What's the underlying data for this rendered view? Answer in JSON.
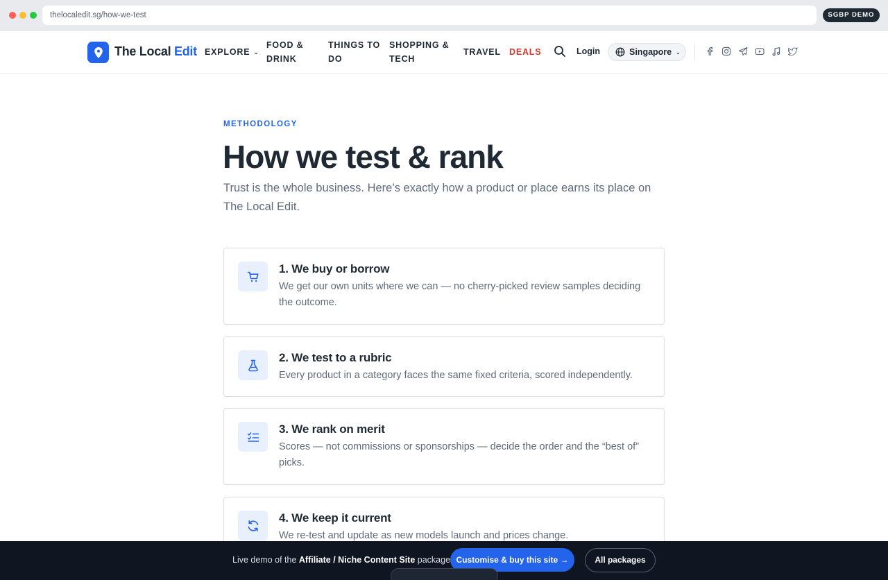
{
  "browser": {
    "url": "thelocaledit.sg/how-we-test",
    "demo_badge": "SGBP DEMO"
  },
  "header": {
    "logo_name": "The Local",
    "logo_accent": "Edit",
    "nav": {
      "explore": "EXPLORE",
      "food_line1": "FOOD &",
      "food_line2": "DRINK",
      "things_line1": "THINGS TO",
      "things_line2": "DO",
      "shopping_line1": "SHOPPING &",
      "shopping_line2": "TECH",
      "travel": "TRAVEL",
      "deals": "DEALS"
    },
    "login": "Login",
    "region": "Singapore",
    "socials": [
      "facebook-icon",
      "instagram-icon",
      "telegram-icon",
      "youtube-icon",
      "tiktok-icon",
      "twitter-icon"
    ]
  },
  "main": {
    "eyebrow": "METHODOLOGY",
    "title": "How we test & rank",
    "lede": "Trust is the whole business. Here’s exactly how a product or place earns its place on The Local Edit.",
    "steps": [
      {
        "title": "1. We buy or borrow",
        "desc": "We get our own units where we can — no cherry-picked review samples deciding the outcome.",
        "icon": "shopping-cart-icon"
      },
      {
        "title": "2. We test to a rubric",
        "desc": "Every product in a category faces the same fixed criteria, scored independently.",
        "icon": "flask-icon"
      },
      {
        "title": "3. We rank on merit",
        "desc": "Scores — not commissions or sponsorships — decide the order and the “best of” picks.",
        "icon": "checklist-icon"
      },
      {
        "title": "4. We keep it current",
        "desc": "We re-test and update as new models launch and prices change.",
        "icon": "refresh-icon"
      }
    ]
  },
  "banner": {
    "prefix": "Live demo of the",
    "package_name": "Affiliate / Niche Content Site",
    "suffix": "package.",
    "primary_cta": "Customise & buy this site →",
    "secondary_cta": "All packages"
  },
  "colors": {
    "brand_blue": "#2464eb",
    "deals_red": "#d43a2f",
    "banner_bg": "#0f1521"
  }
}
